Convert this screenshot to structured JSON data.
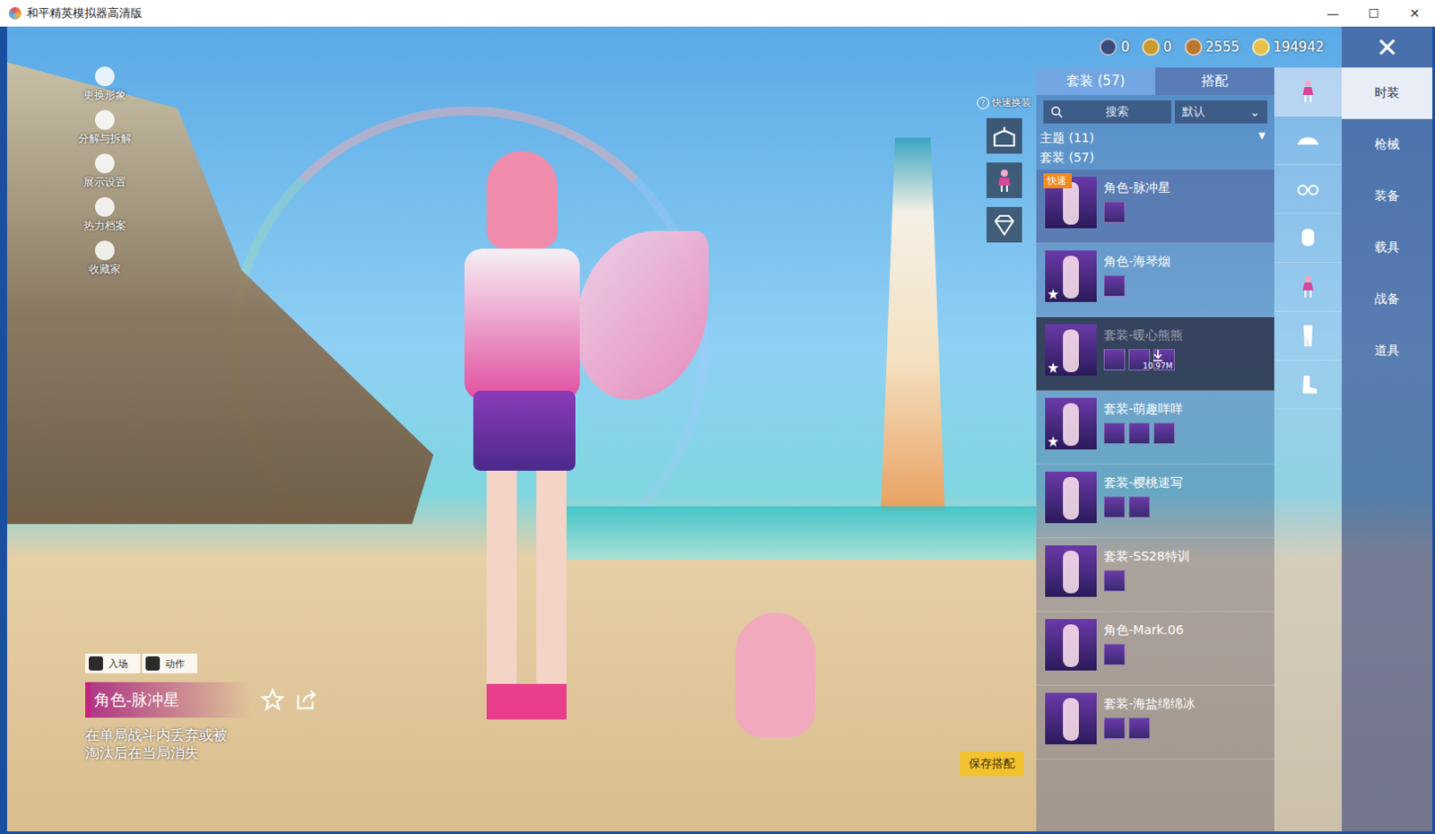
{
  "window": {
    "title": "和平精英模拟器高清版",
    "controls": [
      "—",
      "☐",
      "✕"
    ]
  },
  "side_menu": [
    {
      "label": "更换形象"
    },
    {
      "label": "分解与拆解"
    },
    {
      "label": "展示设置"
    },
    {
      "label": "热力档案"
    },
    {
      "label": "收藏家"
    }
  ],
  "currencies": [
    {
      "amount": "0",
      "color": "#3a4a7a"
    },
    {
      "amount": "0",
      "color": "#c99a2e"
    },
    {
      "amount": "2555",
      "color": "#b9772e"
    },
    {
      "amount": "194942",
      "color": "#e6c04a"
    }
  ],
  "close": "✕",
  "quick_change": {
    "label": "快速换装",
    "help": "?"
  },
  "panel": {
    "tabs": [
      {
        "label": "套装 (57)",
        "selected": true
      },
      {
        "label": "搭配",
        "selected": false
      }
    ],
    "search": {
      "placeholder": "搜索"
    },
    "sort": {
      "value": "默认",
      "arrow": "⌄"
    },
    "theme_group": {
      "label": "主题 (11)",
      "arrow": "▼"
    },
    "section_label": "套装 (57)",
    "items": [
      {
        "name": "角色-脉冲星",
        "badge": "快速",
        "selected": true,
        "starred": false,
        "downloading": false,
        "parts": 1
      },
      {
        "name": "角色-海琴烟",
        "badge": "",
        "selected": false,
        "starred": true,
        "downloading": false,
        "parts": 1
      },
      {
        "name": "套装-暖心熊熊",
        "badge": "",
        "selected": false,
        "starred": true,
        "downloading": true,
        "size": "10.97M",
        "parts": 3
      },
      {
        "name": "套装-萌趣咩咩",
        "badge": "",
        "selected": false,
        "starred": true,
        "downloading": false,
        "parts": 3
      },
      {
        "name": "套装-樱桃速写",
        "badge": "",
        "selected": false,
        "starred": false,
        "downloading": false,
        "parts": 2
      },
      {
        "name": "套装-SS28特训",
        "badge": "",
        "selected": false,
        "starred": false,
        "downloading": false,
        "parts": 1
      },
      {
        "name": "角色-Mark.06",
        "badge": "",
        "selected": false,
        "starred": false,
        "downloading": false,
        "parts": 1
      },
      {
        "name": "套装-海盐绵绵冰",
        "badge": "",
        "selected": false,
        "starred": false,
        "downloading": false,
        "parts": 2
      }
    ]
  },
  "categories": [
    {
      "selected": true
    },
    {
      "selected": false
    },
    {
      "selected": false
    },
    {
      "selected": false
    },
    {
      "selected": false
    },
    {
      "selected": false
    },
    {
      "selected": false
    }
  ],
  "main_tabs": [
    {
      "label": "时装",
      "selected": true
    },
    {
      "label": "枪械",
      "selected": false
    },
    {
      "label": "装备",
      "selected": false
    },
    {
      "label": "载具",
      "selected": false
    },
    {
      "label": "战备",
      "selected": false
    },
    {
      "label": "道具",
      "selected": false
    }
  ],
  "preview": {
    "actions": [
      {
        "label": "入场"
      },
      {
        "label": "动作"
      }
    ],
    "name": "角色-脉冲星",
    "description": "在单局战斗内丢弃或被淘汰后在当局消失",
    "save": "保存搭配"
  }
}
